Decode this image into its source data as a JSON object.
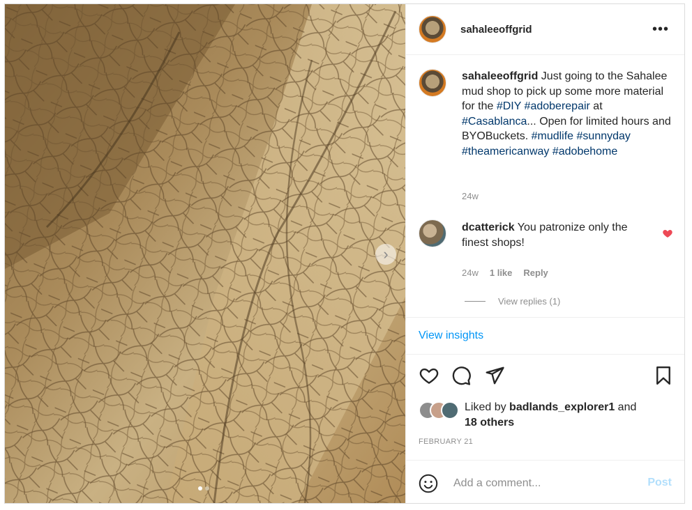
{
  "post": {
    "username": "sahaleeoffgrid",
    "more_icon": "more-horizontal-icon",
    "media": {
      "next_icon": "chevron-right-icon",
      "slide_count": 2,
      "active_slide": 1
    }
  },
  "caption": {
    "username": "sahaleeoffgrid",
    "text_1": " Just going to the Sahalee mud shop to pick up some more material for the ",
    "tag_diy": "#DIY",
    "tag_adoberepair": "#adoberepair",
    "text_2": " at ",
    "tag_casablanca": "#Casablanca",
    "text_3": "... Open for limited hours and BYOBuckets. ",
    "tag_mudlife": "#mudlife",
    "tag_sunnyday": "#sunnyday",
    "tag_theamericanway": "#theamericanway",
    "tag_adobehome": "#adobehome",
    "time": "24w"
  },
  "comment": {
    "username": "dcatterick",
    "text": " You patronize only the finest shops!",
    "time": "24w",
    "likes": "1 like",
    "reply": "Reply",
    "view_replies": "View replies (1)",
    "liked_color": "#ed4956"
  },
  "insights_label": "View insights",
  "actions": {
    "like_icon": "heart-icon",
    "comment_icon": "comment-icon",
    "share_icon": "send-icon",
    "save_icon": "bookmark-icon"
  },
  "likes": {
    "prefix": "Liked by ",
    "user": "badlands_explorer1",
    "middle": " and",
    "others": "18 others"
  },
  "date": "FEBRUARY 21",
  "add_comment": {
    "placeholder": "Add a comment...",
    "post_label": "Post",
    "emoji_icon": "smiley-icon"
  },
  "colors": {
    "link_blue": "#0095f6",
    "hashtag": "#00376b",
    "post_disabled": "#b2dffc"
  }
}
